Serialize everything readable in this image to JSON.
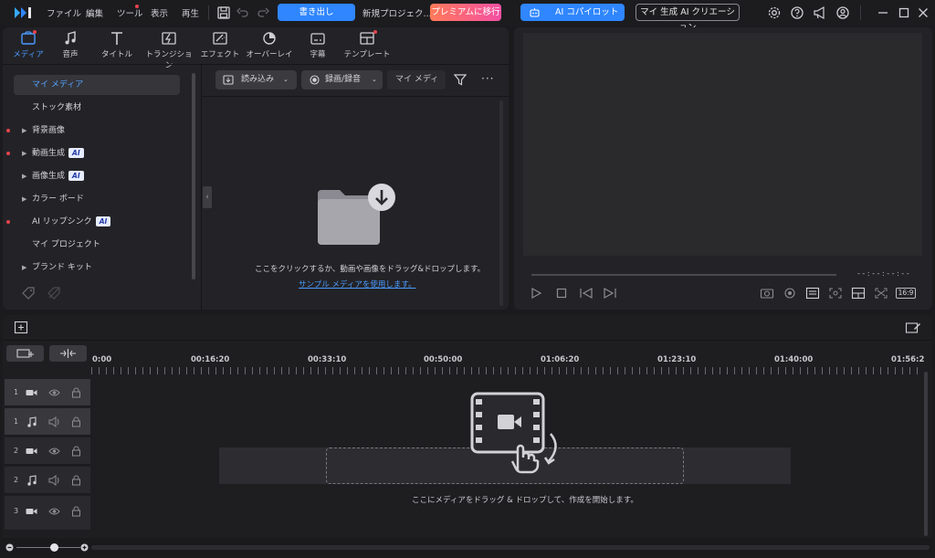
{
  "menu": {
    "file": "ファイル",
    "edit": "編集",
    "tools": "ツール",
    "view": "表示",
    "play": "再生",
    "export_label": "書き出し",
    "project_title": "新規プロジェク...",
    "premium_label": "プレミアムに移行",
    "ai_copilot_label": "AI コパイロット",
    "ai_creation_label": "マイ 生成 AI クリエーション"
  },
  "tabs": [
    {
      "label": "メディア"
    },
    {
      "label": "音声"
    },
    {
      "label": "タイトル"
    },
    {
      "label": "トランジション"
    },
    {
      "label": "エフェクト"
    },
    {
      "label": "オーバーレイ"
    },
    {
      "label": "字幕"
    },
    {
      "label": "テンプレート"
    }
  ],
  "sidebar": {
    "items": [
      {
        "label": "マイ メディア"
      },
      {
        "label": "ストック素材"
      },
      {
        "label": "背景画像"
      },
      {
        "label": "動画生成"
      },
      {
        "label": "画像生成"
      },
      {
        "label": "カラー ボード"
      },
      {
        "label": "AI リップシンク"
      },
      {
        "label": "マイ プロジェクト"
      },
      {
        "label": "ブランド キット"
      }
    ],
    "ai_badge": "AI"
  },
  "toolbar": {
    "import_label": "読み込み",
    "record_label": "録画/録音",
    "search_placeholder": "マイ メディ"
  },
  "media": {
    "empty_hint": "ここをクリックするか、動画や画像をドラッグ&ドロップします。",
    "sample_link": "サンプル メディアを使用します。"
  },
  "preview": {
    "timecode": "- - : - - : - - : - -",
    "ratio": "16:9"
  },
  "timeline": {
    "ruler": [
      "0:00",
      "00:16:20",
      "00:33:10",
      "00:50:00",
      "01:06:20",
      "01:23:10",
      "01:40:00",
      "01:56:2"
    ],
    "tracks": [
      {
        "num": "1",
        "kind": "video"
      },
      {
        "num": "1",
        "kind": "audio"
      },
      {
        "num": "2",
        "kind": "video"
      },
      {
        "num": "2",
        "kind": "audio"
      },
      {
        "num": "3",
        "kind": "video"
      }
    ],
    "drop_hint": "ここにメディアをドラッグ & ドロップして、作成を開始します。"
  },
  "colors": {
    "accent": "#2f86ff",
    "active_tab": "#4b9bff",
    "notify_dot": "#e8434b"
  }
}
